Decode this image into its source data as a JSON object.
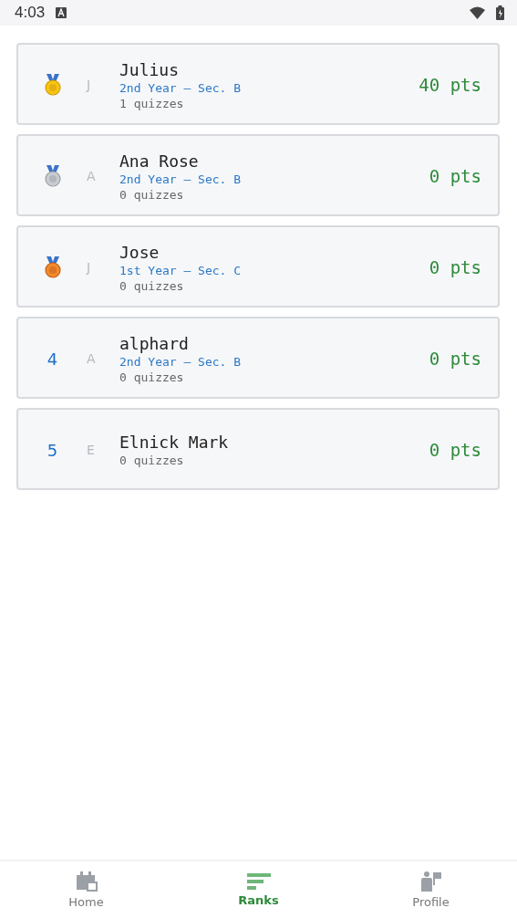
{
  "status_bar": {
    "time": "4:03"
  },
  "leaderboard": [
    {
      "badge": {
        "kind": "gold"
      },
      "initial": "J",
      "name": "Julius",
      "section": "2nd Year — Sec. B",
      "quizzes": "1 quizzes",
      "points": "40 pts"
    },
    {
      "badge": {
        "kind": "silver"
      },
      "initial": "A",
      "name": "Ana Rose",
      "section": "2nd Year — Sec. B",
      "quizzes": "0 quizzes",
      "points": "0 pts"
    },
    {
      "badge": {
        "kind": "bronze"
      },
      "initial": "J",
      "name": "Jose",
      "section": "1st Year — Sec. C",
      "quizzes": "0 quizzes",
      "points": "0 pts"
    },
    {
      "badge": {
        "kind": "number",
        "text": "4"
      },
      "initial": "A",
      "name": "alphard",
      "section": "2nd Year — Sec. B",
      "quizzes": "0 quizzes",
      "points": "0 pts"
    },
    {
      "badge": {
        "kind": "number",
        "text": "5"
      },
      "initial": "E",
      "name": "Elnick Mark",
      "quizzes": "0 quizzes",
      "points": "0 pts"
    }
  ],
  "bottom_nav": [
    {
      "kind": "home",
      "label": "Home",
      "selected": false
    },
    {
      "kind": "ranks",
      "label": "Ranks",
      "selected": true
    },
    {
      "kind": "profile",
      "label": "Profile",
      "selected": false
    }
  ]
}
